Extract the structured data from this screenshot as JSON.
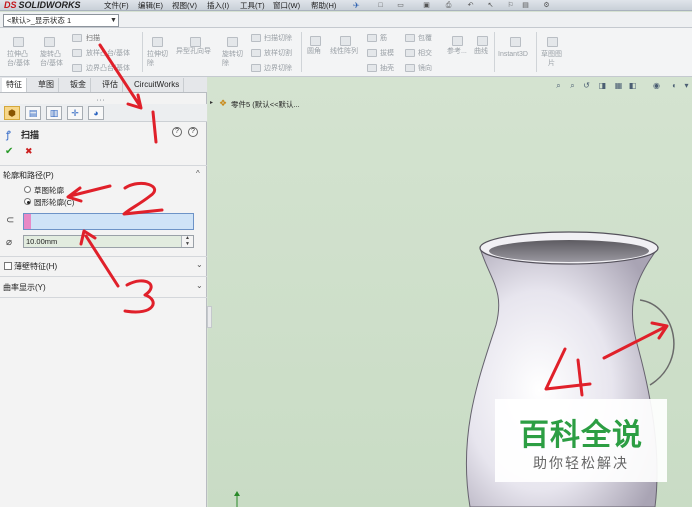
{
  "app": {
    "logo_prefix": "DS",
    "logo_name": "SOLIDWORKS"
  },
  "menu": [
    "文件(F)",
    "编辑(E)",
    "视图(V)",
    "插入(I)",
    "工具(T)",
    "窗口(W)",
    "帮助(H)"
  ],
  "config": {
    "value": "<默认>_显示状态 1"
  },
  "ribbon": {
    "items": [
      {
        "l1": "拉伸凸",
        "l2": "台/基体"
      },
      {
        "l1": "旋转凸",
        "l2": "台/基体"
      },
      {
        "l1": "扫描",
        "l2": ""
      },
      {
        "l1": "放样凸台/基体",
        "l2": ""
      },
      {
        "l1": "边界凸台/基体",
        "l2": ""
      },
      {
        "l1": "拉伸切",
        "l2": "除"
      },
      {
        "l1": "异型孔向导",
        "l2": ""
      },
      {
        "l1": "旋转切",
        "l2": "除"
      },
      {
        "l1": "扫描切除",
        "l2": ""
      },
      {
        "l1": "放样切割",
        "l2": ""
      },
      {
        "l1": "边界切除",
        "l2": ""
      },
      {
        "l1": "圆角",
        "l2": ""
      },
      {
        "l1": "线性阵列",
        "l2": ""
      },
      {
        "l1": "筋",
        "l2": ""
      },
      {
        "l1": "拔模",
        "l2": ""
      },
      {
        "l1": "抽壳",
        "l2": ""
      },
      {
        "l1": "包覆",
        "l2": ""
      },
      {
        "l1": "相交",
        "l2": ""
      },
      {
        "l1": "镜向",
        "l2": ""
      },
      {
        "l1": "参考...",
        "l2": ""
      },
      {
        "l1": "曲线",
        "l2": ""
      },
      {
        "l1": "Instant3D",
        "l2": ""
      },
      {
        "l1": "草图图",
        "l2": "片"
      }
    ]
  },
  "tabs": [
    "特征",
    "草图",
    "钣金",
    "评估",
    "CircuitWorks"
  ],
  "property_manager": {
    "title": "扫描",
    "section_profile": "轮廓和路径(P)",
    "radio_sketch": "草图轮廓",
    "radio_circle": "圆形轮廓(C)",
    "diameter": "10.00mm",
    "section_thin": "薄壁特征(H)",
    "section_curvature": "曲率显示(Y)"
  },
  "tree": {
    "item": "零件5 (默认<<默认..."
  },
  "annotations": [
    "1",
    "2",
    "3",
    "4"
  ],
  "watermark": {
    "title": "百科全说",
    "subtitle": "助你轻松解决"
  },
  "colors": {
    "accent_red": "#e0202a",
    "selection_pink": "#e889c6",
    "viewport_bg": "#d4e3d0",
    "watermark_green": "#2c9e43"
  }
}
